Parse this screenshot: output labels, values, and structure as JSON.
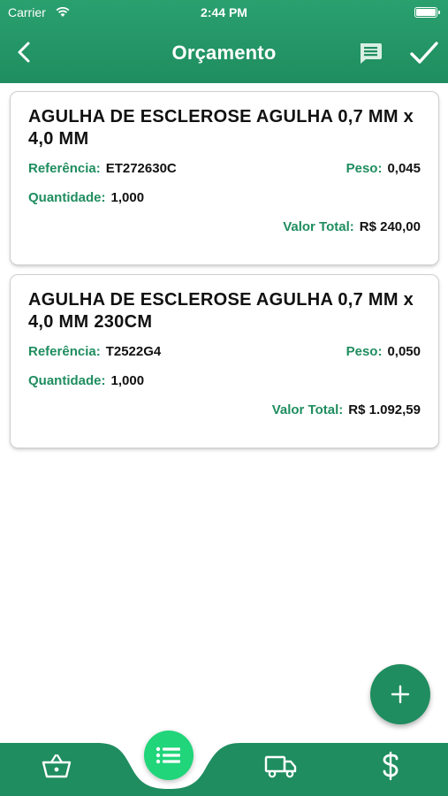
{
  "status_bar": {
    "carrier": "Carrier",
    "time": "2:44 PM"
  },
  "header": {
    "title": "Orçamento",
    "back_icon": "chevron-left-icon",
    "comment_icon": "chat-icon",
    "confirm_icon": "check-icon"
  },
  "labels": {
    "reference": "Referência:",
    "weight": "Peso:",
    "quantity": "Quantidade:",
    "total": "Valor Total:"
  },
  "items": [
    {
      "name": "AGULHA DE ESCLEROSE AGULHA 0,7 MM x 4,0 MM",
      "reference": "ET272630C",
      "weight": "0,045",
      "quantity": "1,000",
      "total": "R$ 240,00"
    },
    {
      "name": "AGULHA DE ESCLEROSE AGULHA 0,7 MM x 4,0 MM 230CM",
      "reference": "T2522G4",
      "weight": "0,050",
      "quantity": "1,000",
      "total": "R$ 1.092,59"
    }
  ],
  "fab_icon": "plus-icon",
  "tab_bar": {
    "items": [
      "basket-icon",
      "list-icon",
      "truck-icon",
      "dollar-icon"
    ],
    "active": "list-icon"
  },
  "colors": {
    "primary": "#1f8d5f",
    "primary_light": "#2aa06f",
    "accent": "#20d57a",
    "text": "#111111"
  }
}
